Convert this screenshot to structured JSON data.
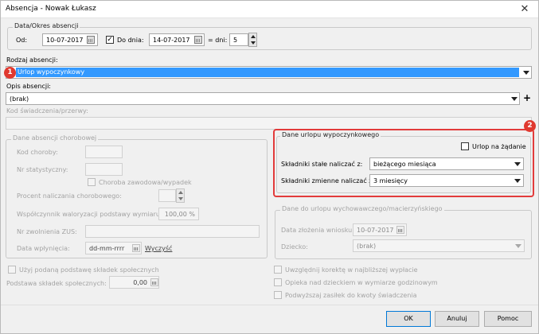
{
  "window": {
    "title": "Absencja - Nowak Łukasz",
    "close_glyph": "✕"
  },
  "date_section": {
    "title": "Data/Okres absencji",
    "from_label": "Od:",
    "from_value": "10-07-2017",
    "to_checkbox_label": "Do dnia:",
    "to_checked": true,
    "to_value": "14-07-2017",
    "days_label": "= dni:",
    "days_value": "5"
  },
  "absence_type": {
    "label": "Rodzaj absencji:",
    "value": "Urlop wypoczynkowy",
    "badge": "1"
  },
  "absence_desc": {
    "label": "Opis absencji:",
    "value": "(brak)",
    "add_glyph": "+"
  },
  "benefit_code": {
    "label": "Kod świadczenia/przerwy:",
    "value": ""
  },
  "sick": {
    "title": "Dane absencji chorobowej",
    "illness_code_label": "Kod choroby:",
    "stat_no_label": "Nr statystyczny:",
    "occupational_label": "Choroba zawodowa/wypadek",
    "percent_label": "Procent naliczania chorobowego:",
    "coefficient_label": "Współczynnik waloryzacji podstawy wymiaru:",
    "coefficient_value": "100,00 %",
    "zus_no_label": "Nr zwolnienia ZUS:",
    "receipt_date_label": "Data wpłynięcia:",
    "receipt_date_placeholder": "dd-mm-rrrr",
    "clear_link": "Wyczyść"
  },
  "vacation": {
    "title": "Dane urlopu wypoczynkowego",
    "on_demand_label": "Urlop na żądanie",
    "fixed_label": "Składniki stałe naliczać z:",
    "fixed_value": "bieżącego miesiąca",
    "variable_label": "Składniki zmienne naliczać z:",
    "variable_value": "3 miesięcy",
    "badge": "2"
  },
  "parental": {
    "title": "Dane do urlopu wychowawczego/macierzyńskiego",
    "request_date_label": "Data złożenia wniosku:",
    "request_date_value": "10-07-2017",
    "child_label": "Dziecko:",
    "child_value": "(brak)"
  },
  "social": {
    "use_base_label": "Użyj podaną podstawę składek społecznych",
    "base_label": "Podstawa składek społecznych:",
    "base_value": "0,00"
  },
  "options": {
    "correction_label": "Uwzględnij korektę w najbliższej wypłacie",
    "childcare_label": "Opieka nad dzieckiem w wymiarze godzinowym",
    "raise_label": "Podwyższaj zasiłek do kwoty świadczenia"
  },
  "buttons": {
    "ok": "OK",
    "cancel": "Anuluj",
    "help": "Pomoc"
  },
  "colors": {
    "selection": "#3399ff",
    "highlight": "#e23b3b",
    "badge": "#e0392f"
  }
}
